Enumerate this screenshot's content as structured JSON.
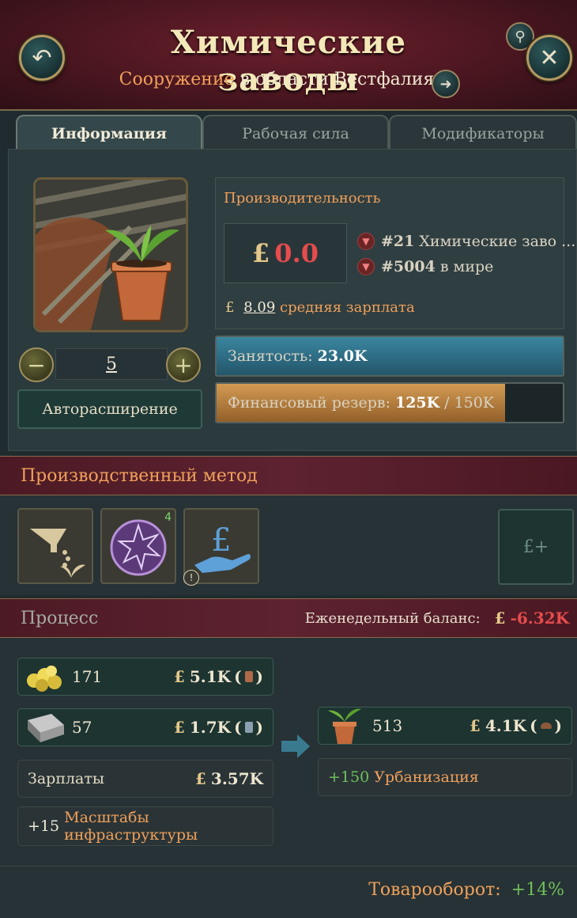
{
  "header": {
    "title": "Химические заводы",
    "subtitle_type": "Сооружение",
    "subtitle_mid": "в области",
    "subtitle_region": "Вестфалия"
  },
  "tabs": [
    {
      "label": "Информация",
      "active": true
    },
    {
      "label": "Рабочая сила",
      "active": false
    },
    {
      "label": "Модификаторы",
      "active": false
    }
  ],
  "productivity": {
    "title": "Производительность",
    "currency": "£",
    "value": "0.0",
    "rank1_num": "#21",
    "rank1_label": "Химические заво ...",
    "rank2_num": "#5004",
    "rank2_label": "в мире",
    "wage_value": "8.09",
    "wage_label": "средняя зарплата"
  },
  "level": {
    "value": "5",
    "auto_expand_label": "Авторасширение"
  },
  "employment": {
    "label": "Занятость:",
    "value": "23.0K",
    "fill_fraction": 1.0
  },
  "reserve": {
    "label": "Финансовый резерв:",
    "value": "125K",
    "separator": "/",
    "max": "150K",
    "fill_fraction": 0.8333
  },
  "production_method": {
    "title": "Производственный метод",
    "badge": "4",
    "add_symbol": "£+"
  },
  "process": {
    "title": "Процесс",
    "balance_label": "Еженедельный баланс:",
    "balance_value": "-6.32K",
    "inputs": [
      {
        "amount": "171",
        "value": "5.1K"
      },
      {
        "amount": "57",
        "value": "1.7K"
      }
    ],
    "wages_label": "Зарплаты",
    "wages_value": "3.57K",
    "infra_value": "+15",
    "infra_label": "Масштабы инфраструктуры",
    "output": {
      "amount": "513",
      "value": "4.1K"
    },
    "urban_value": "+150",
    "urban_label": "Урбанизация"
  },
  "footer": {
    "turnover_label": "Товарооборот:",
    "turnover_value": "+14%"
  },
  "colors": {
    "accent": "#f0a05a",
    "employment_bar": "#2d6f86",
    "reserve_bar": "#b47a3c",
    "negative": "#e64c4c",
    "positive": "#6fbf5a"
  }
}
